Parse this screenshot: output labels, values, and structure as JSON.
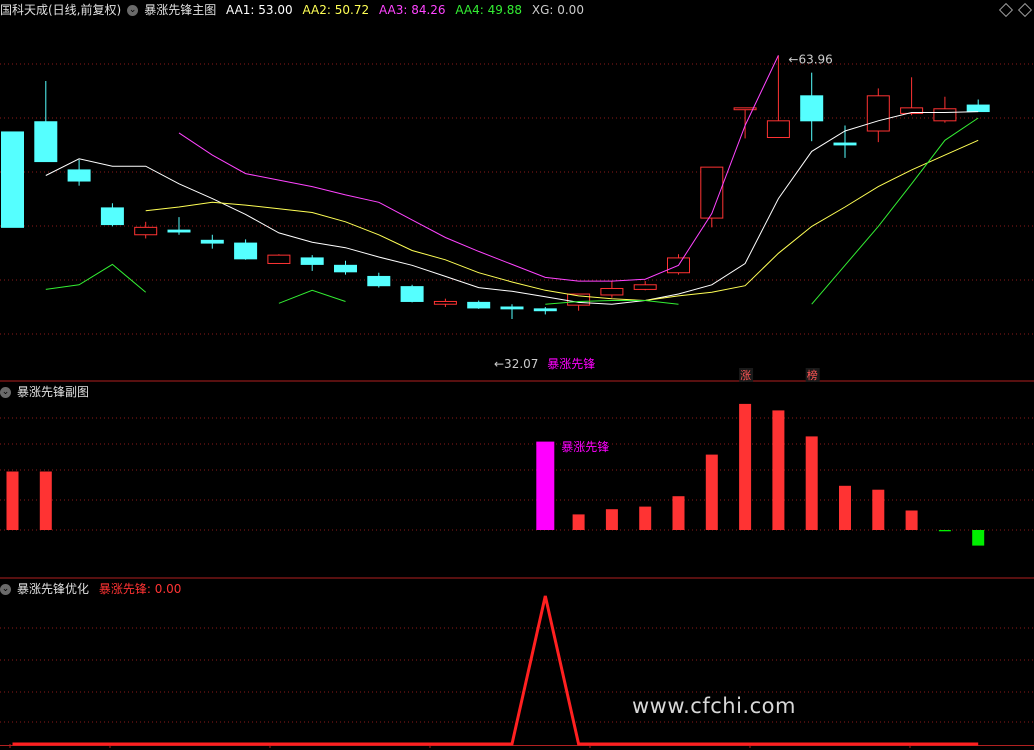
{
  "main_header": {
    "stock": "国科天成(日线,前复权)",
    "indicator": "暴涨先锋主图",
    "items": [
      {
        "label": "AA1:",
        "value": "53.00",
        "color": "#ffffff"
      },
      {
        "label": "AA2:",
        "value": "50.72",
        "color": "#ffff55"
      },
      {
        "label": "AA3:",
        "value": "84.26",
        "color": "#ff44ff"
      },
      {
        "label": "AA4:",
        "value": "49.88",
        "color": "#33ee33"
      },
      {
        "label": "XG:",
        "value": "0.00",
        "color": "#cccccc"
      }
    ]
  },
  "sub_header": {
    "indicator": "暴涨先锋副图"
  },
  "opt_header": {
    "indicator": "暴涨先锋优化",
    "label": "暴涨先锋:",
    "value": "0.00"
  },
  "annotations": {
    "high": "63.96",
    "low": "32.07",
    "signal_main": "暴涨先锋",
    "signal_sub": "暴涨先锋",
    "tag1": "涨",
    "tag2": "榜"
  },
  "watermark": "www.cfchi.com",
  "colors": {
    "up": "#ff3333",
    "down": "#55ffff",
    "aa1": "#ffffff",
    "aa2": "#ffff55",
    "aa3": "#ff44ff",
    "aa4": "#33ee33",
    "grid": "#8b1a1a",
    "signal": "#ff00ff"
  },
  "chart_data": [
    {
      "type": "candlestick",
      "title": "暴涨先锋主图",
      "ylim": [
        30,
        68
      ],
      "candles": [
        {
          "o": 55.7,
          "c": 45.4,
          "h": 55.7,
          "l": 45.4
        },
        {
          "o": 56.8,
          "c": 52.5,
          "h": 61.2,
          "l": 52.5
        },
        {
          "o": 51.6,
          "c": 50.4,
          "h": 52.7,
          "l": 49.9
        },
        {
          "o": 47.5,
          "c": 45.7,
          "h": 48.0,
          "l": 45.5
        },
        {
          "o": 44.6,
          "c": 45.4,
          "h": 46.0,
          "l": 44.2
        },
        {
          "o": 45.1,
          "c": 44.9,
          "h": 46.5,
          "l": 44.6
        },
        {
          "o": 44.0,
          "c": 43.7,
          "h": 44.6,
          "l": 43.1
        },
        {
          "o": 43.7,
          "c": 42.0,
          "h": 44.1,
          "l": 41.9
        },
        {
          "o": 41.5,
          "c": 42.4,
          "h": 42.5,
          "l": 41.5
        },
        {
          "o": 42.1,
          "c": 41.4,
          "h": 42.4,
          "l": 40.7
        },
        {
          "o": 41.3,
          "c": 40.6,
          "h": 41.8,
          "l": 40.3
        },
        {
          "o": 40.1,
          "c": 39.1,
          "h": 40.5,
          "l": 38.9
        },
        {
          "o": 39.0,
          "c": 37.4,
          "h": 39.2,
          "l": 37.3
        },
        {
          "o": 37.1,
          "c": 37.4,
          "h": 37.7,
          "l": 36.8
        },
        {
          "o": 37.3,
          "c": 36.7,
          "h": 37.5,
          "l": 36.6
        },
        {
          "o": 36.8,
          "c": 36.6,
          "h": 37.1,
          "l": 35.5
        },
        {
          "o": 36.6,
          "c": 36.4,
          "h": 36.8,
          "l": 36.0
        },
        {
          "o": 37.0,
          "c": 38.2,
          "h": 38.2,
          "l": 36.4
        },
        {
          "o": 38.1,
          "c": 38.8,
          "h": 39.6,
          "l": 37.8
        },
        {
          "o": 38.7,
          "c": 39.2,
          "h": 39.6,
          "l": 38.6
        },
        {
          "o": 40.5,
          "c": 42.1,
          "h": 42.5,
          "l": 40.3
        },
        {
          "o": 46.4,
          "c": 51.9,
          "h": 51.9,
          "l": 45.4
        },
        {
          "o": 58.1,
          "c": 58.3,
          "h": 58.3,
          "l": 55.0
        },
        {
          "o": 55.1,
          "c": 56.9,
          "h": 63.96,
          "l": 55.1
        },
        {
          "o": 59.6,
          "c": 56.9,
          "h": 62.1,
          "l": 54.7
        },
        {
          "o": 54.5,
          "c": 54.3,
          "h": 56.4,
          "l": 52.9
        },
        {
          "o": 55.8,
          "c": 59.6,
          "h": 60.4,
          "l": 54.6
        },
        {
          "o": 57.7,
          "c": 58.3,
          "h": 61.6,
          "l": 57.5
        },
        {
          "o": 56.9,
          "c": 58.2,
          "h": 59.5,
          "l": 56.7
        },
        {
          "o": 58.6,
          "c": 57.9,
          "h": 59.2,
          "l": 57.9
        }
      ],
      "aa1": [
        null,
        51.0,
        52.8,
        52.0,
        52.0,
        50.1,
        48.5,
        46.8,
        44.8,
        43.8,
        43.2,
        42.2,
        41.3,
        40.1,
        38.9,
        38.5,
        37.9,
        37.3,
        37.1,
        37.5,
        38.2,
        39.2,
        41.5,
        48.5,
        53.6,
        55.8,
        56.9,
        57.8,
        57.8,
        57.9
      ],
      "aa2": [
        null,
        null,
        null,
        null,
        47.2,
        47.6,
        48.1,
        47.8,
        47.4,
        47.0,
        46.0,
        44.6,
        42.9,
        41.9,
        40.5,
        39.5,
        38.6,
        38.0,
        37.7,
        37.5,
        38.0,
        38.4,
        39.1,
        42.6,
        45.5,
        47.6,
        49.8,
        51.6,
        53.2,
        54.8
      ],
      "aa3": [
        null,
        null,
        null,
        null,
        null,
        55.6,
        53.2,
        51.2,
        50.5,
        49.8,
        48.9,
        48.1,
        46.2,
        44.3,
        42.8,
        41.4,
        40.0,
        39.6,
        39.6,
        39.8,
        41.3,
        46.9,
        56.4,
        63.96,
        null,
        null,
        null,
        null,
        null,
        null
      ],
      "aa4_segments": [
        [
          [
            1,
            38.7
          ],
          [
            2,
            39.2
          ],
          [
            3,
            41.4
          ],
          [
            4,
            38.4
          ]
        ],
        [
          [
            8,
            37.2
          ],
          [
            9,
            38.6
          ],
          [
            10,
            37.4
          ]
        ],
        [
          [
            16,
            37.1
          ],
          [
            17,
            37.4
          ],
          [
            18,
            37.5
          ],
          [
            19,
            37.5
          ],
          [
            20,
            37.1
          ]
        ],
        [
          [
            24,
            37.1
          ],
          [
            25,
            41.3
          ],
          [
            26,
            45.5
          ],
          [
            27,
            50.1
          ],
          [
            28,
            54.8
          ],
          [
            29,
            57.2
          ]
        ]
      ],
      "min_label": "32.07",
      "max_label": "63.96",
      "tags": [
        "涨",
        "榜"
      ]
    },
    {
      "type": "bar",
      "title": "暴涨先锋副图",
      "ylim": [
        -10,
        100
      ],
      "values": [
        45,
        45,
        0,
        0,
        0,
        0,
        0,
        0,
        0,
        0,
        0,
        0,
        0,
        0,
        0,
        0,
        68,
        12,
        16,
        18,
        26,
        58,
        97,
        92,
        72,
        34,
        31,
        15,
        -1,
        -12
      ],
      "signal_index": 16,
      "signal_label": "暴涨先锋"
    },
    {
      "type": "line",
      "title": "暴涨先锋优化",
      "ylim": [
        0,
        1
      ],
      "x": [
        0,
        15,
        16,
        17,
        29
      ],
      "values": [
        0,
        0,
        1,
        0,
        0
      ],
      "series": [
        {
          "name": "暴涨先锋",
          "values": [
            0,
            0,
            1,
            0,
            0
          ]
        }
      ]
    }
  ]
}
